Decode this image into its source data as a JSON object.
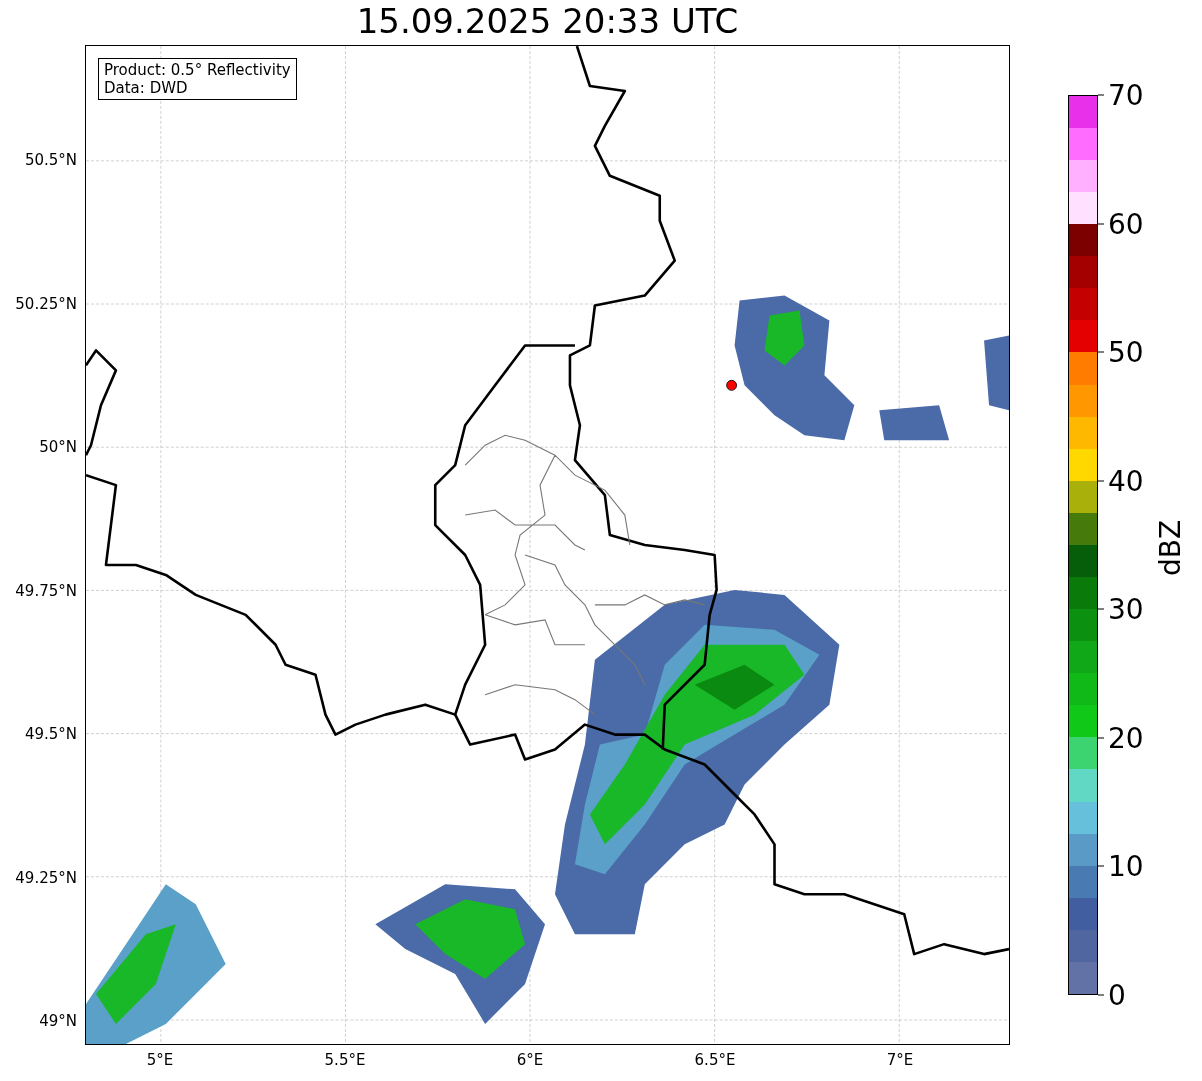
{
  "title": "15.09.2025 20:33 UTC",
  "info_box": [
    "Product: 0.5° Reflectivity",
    "Data: DWD"
  ],
  "map": {
    "x_ticks": [
      "5°E",
      "5.5°E",
      "6°E",
      "6.5°E",
      "7°E"
    ],
    "y_ticks": [
      "50.5°N",
      "50.25°N",
      "50°N",
      "49.75°N",
      "49.5°N",
      "49.25°N",
      "49°N"
    ]
  },
  "colorbar": {
    "label": "dBZ",
    "ticks": [
      "70",
      "60",
      "50",
      "40",
      "30",
      "20",
      "10",
      "0"
    ],
    "segments": [
      {
        "color": "#6272a6"
      },
      {
        "color": "#5066a0"
      },
      {
        "color": "#405ea0"
      },
      {
        "color": "#4a7ab2"
      },
      {
        "color": "#5a9ac6"
      },
      {
        "color": "#66c0dc"
      },
      {
        "color": "#60d8c4"
      },
      {
        "color": "#3cd470"
      },
      {
        "color": "#10c818"
      },
      {
        "color": "#10b818"
      },
      {
        "color": "#10a818"
      },
      {
        "color": "#0c9010"
      },
      {
        "color": "#0a7a0a"
      },
      {
        "color": "#065e0a"
      },
      {
        "color": "#467a0a"
      },
      {
        "color": "#aab00a"
      },
      {
        "color": "#ffd800"
      },
      {
        "color": "#ffb800"
      },
      {
        "color": "#ff9800"
      },
      {
        "color": "#ff7c00"
      },
      {
        "color": "#e40000"
      },
      {
        "color": "#c40000"
      },
      {
        "color": "#a40000"
      },
      {
        "color": "#7c0000"
      },
      {
        "color": "#ffe0ff"
      },
      {
        "color": "#ffb0ff"
      },
      {
        "color": "#ff6cff"
      },
      {
        "color": "#e830ea"
      }
    ]
  }
}
